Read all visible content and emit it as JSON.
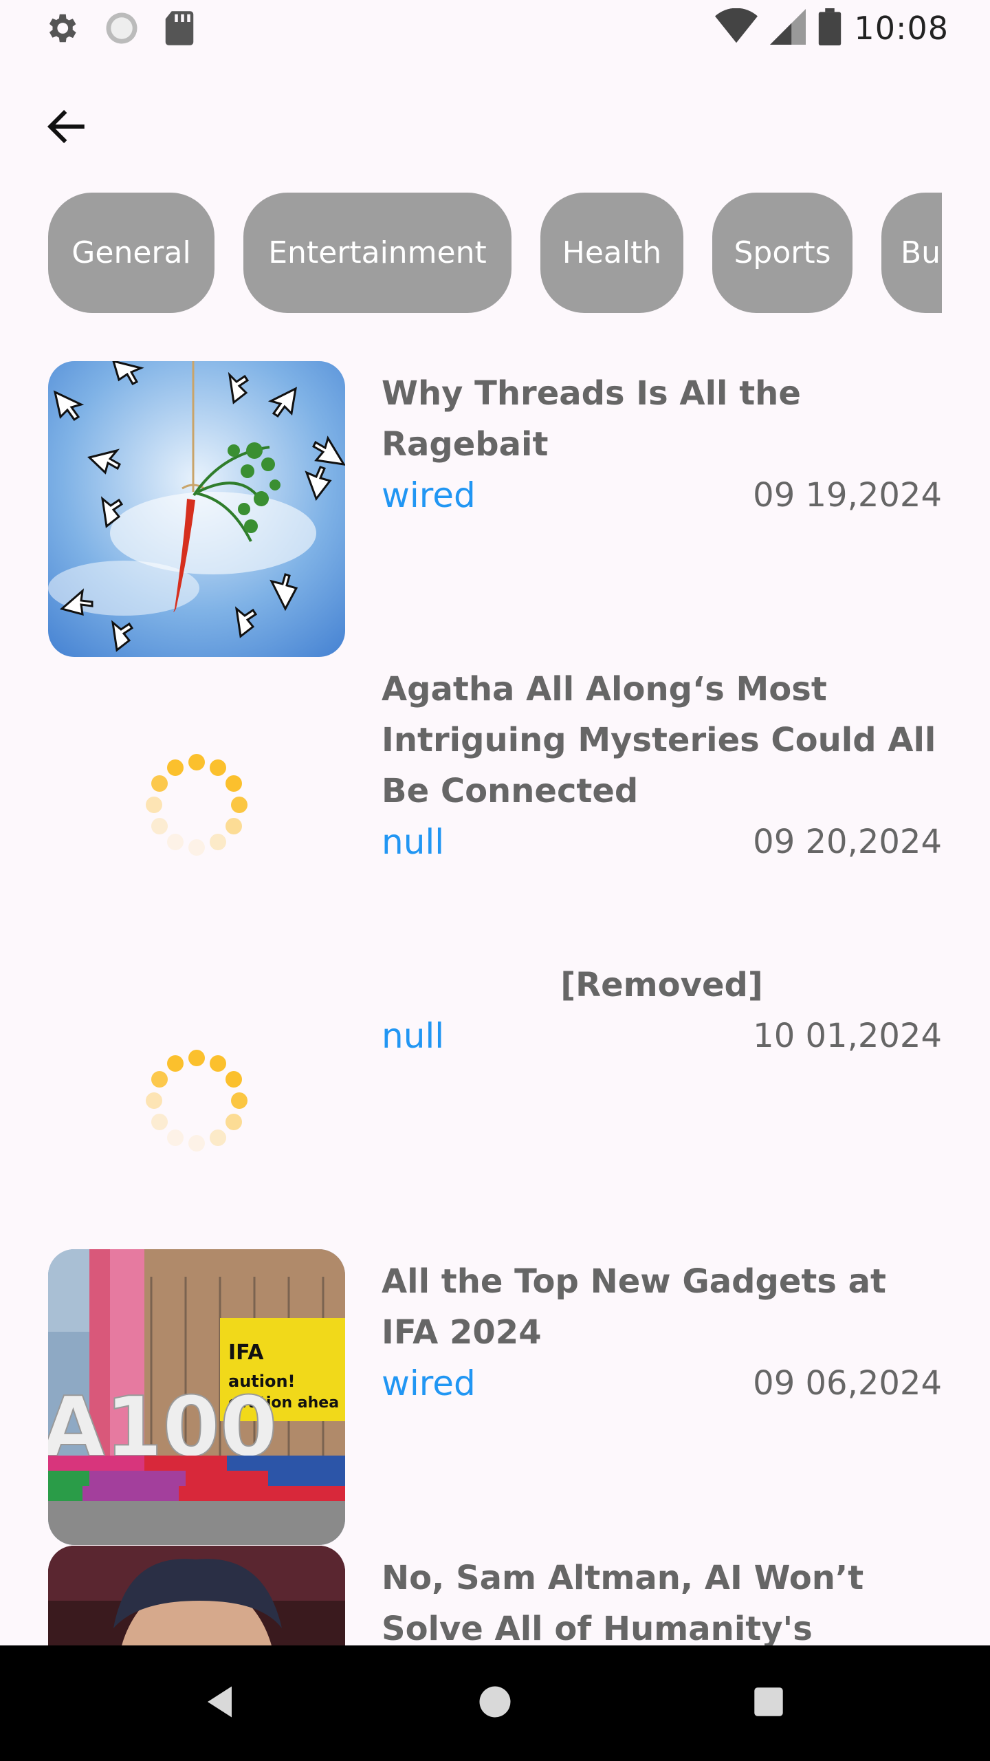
{
  "status_bar": {
    "time": "10:08",
    "icons": [
      "gear-icon",
      "sync-icon",
      "sd-card-icon",
      "wifi-icon",
      "signal-icon",
      "battery-icon"
    ]
  },
  "app_bar": {
    "back_icon": "arrow-back-icon"
  },
  "categories": [
    "General",
    "Entertainment",
    "Health",
    "Sports",
    "Bu"
  ],
  "articles": [
    {
      "title": "Why Threads Is All the Ragebait",
      "source": "wired",
      "date": "09 19,2024",
      "image": "carrot-on-string-with-cursors"
    },
    {
      "title": "Agatha All Along‘s Most Intriguing Mysteries Could All Be Connected",
      "source": "null",
      "date": "09 20,2024",
      "image": "loading-spinner"
    },
    {
      "title": "[Removed]",
      "source": "null",
      "date": "10 01,2024",
      "image": "loading-spinner"
    },
    {
      "title": "All the Top New Gadgets at IFA 2024",
      "source": "wired",
      "date": "09 06,2024",
      "image": "ifa-building-photo"
    },
    {
      "title": "No, Sam Altman, AI Won’t Solve All of Humanity's",
      "source": "",
      "date": "",
      "image": "portrait-photo"
    }
  ],
  "colors": {
    "background": "#fdf8fc",
    "chip": "#9e9e9e",
    "source": "#2196f3",
    "text": "#666666",
    "spinner": "#fbc02d"
  },
  "nav_bar": {
    "icons": [
      "back-triangle-icon",
      "home-circle-icon",
      "recents-square-icon"
    ]
  }
}
